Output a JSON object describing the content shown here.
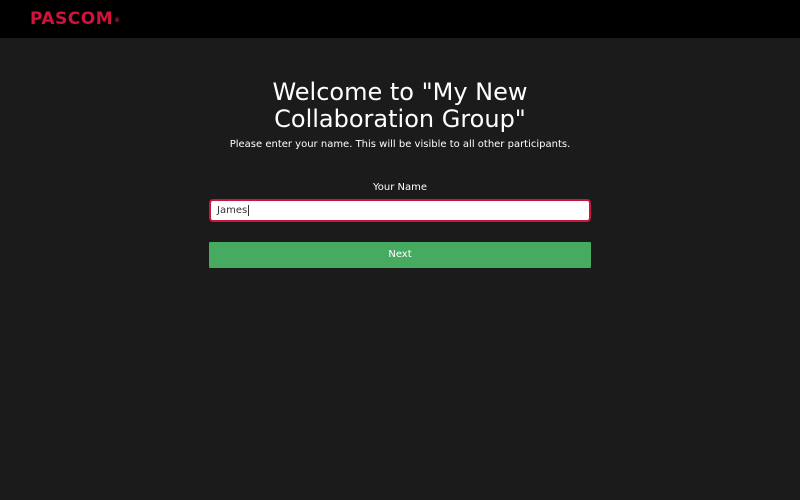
{
  "header": {
    "logo_text": "PASCOM",
    "logo_mark": "®",
    "background_color": "#000000",
    "brand_color": "#d2123a"
  },
  "welcome": {
    "title": "Welcome to \"My New Collaboration Group\"",
    "subtitle": "Please enter your name. This will be visible to all other participants."
  },
  "form": {
    "name_label": "Your Name",
    "name_value": "James",
    "input_border_color": "#c8163d",
    "next_label": "Next",
    "next_color": "#46ab60"
  },
  "page": {
    "background_color": "#1b1b1b"
  }
}
